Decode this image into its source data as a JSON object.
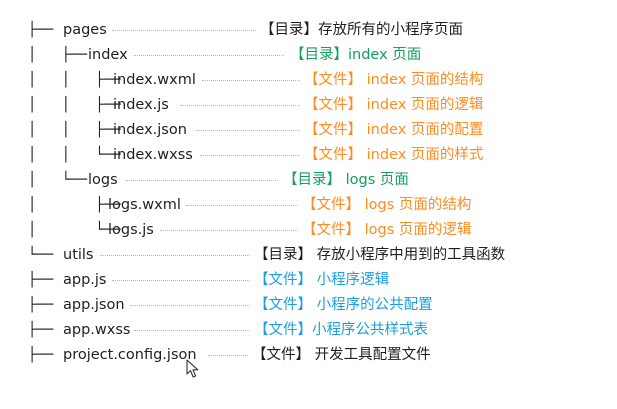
{
  "rows": [
    {
      "prefix": "├── ",
      "name": "pages",
      "desc": "【目录】存放所有的小程序页面",
      "tone": "black"
    },
    {
      "prefix": "│   ├── ",
      "name": "index",
      "desc": "【目录】index 页面",
      "tone": "green"
    },
    {
      "prefix": "│   │   ├── ",
      "name": "index.wxml",
      "desc": "【文件】 index 页面的结构",
      "tone": "orange"
    },
    {
      "prefix": "│   │   ├── ",
      "name": "index.js",
      "desc": "【文件】 index 页面的逻辑",
      "tone": "orange"
    },
    {
      "prefix": "│   │   ├── ",
      "name": "index.json",
      "desc": "【文件】 index 页面的配置",
      "tone": "orange"
    },
    {
      "prefix": "│   │   └── ",
      "name": "index.wxss",
      "desc": "【文件】 index 页面的样式",
      "tone": "orange"
    },
    {
      "prefix": "│   └── ",
      "name": "logs",
      "desc": "【目录】 logs 页面",
      "tone": "green"
    },
    {
      "prefix": "│       ├── ",
      "name": "logs.wxml",
      "desc": "【文件】 logs 页面的结构",
      "tone": "orange"
    },
    {
      "prefix": "│       └── ",
      "name": "logs.js",
      "desc": "【文件】 logs 页面的逻辑",
      "tone": "orange"
    },
    {
      "prefix": "└── ",
      "name": "utils",
      "desc": "【目录】 存放小程序中用到的工具函数",
      "tone": "black"
    },
    {
      "prefix": "├── ",
      "name": "app.js",
      "desc": "【文件】 小程序逻辑",
      "tone": "blue"
    },
    {
      "prefix": "├── ",
      "name": "app.json",
      "desc": "【文件】 小程序的公共配置",
      "tone": "blue"
    },
    {
      "prefix": "├── ",
      "name": "app.wxss",
      "desc": "【文件】小程序公共样式表",
      "tone": "blue"
    },
    {
      "prefix": "├── ",
      "name": "project.config.json",
      "desc": "【文件】 开发工具配置文件",
      "tone": "black"
    }
  ],
  "colors": {
    "green": "#13a05a",
    "orange": "#ff8c1f",
    "blue": "#1aa0dc",
    "black": "#1f1f1f",
    "dots": "#b9b9b9"
  }
}
